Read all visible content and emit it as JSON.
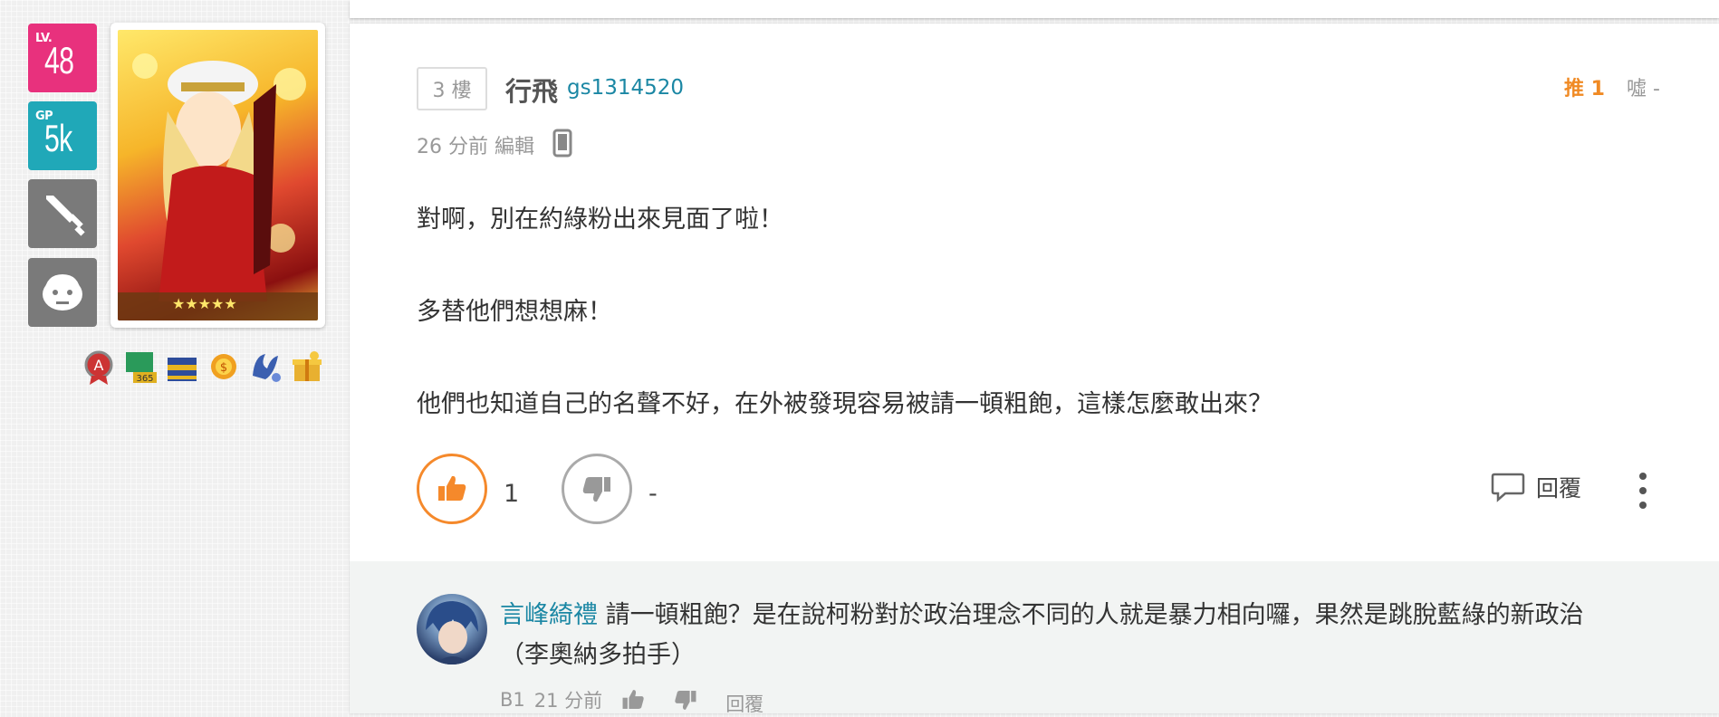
{
  "sidebar": {
    "level": {
      "caption": "LV.",
      "value": "48"
    },
    "gp": {
      "caption": "GP",
      "value": "5k"
    }
  },
  "post": {
    "floor": "3 樓",
    "author_name": "行飛",
    "author_id": "gs1314520",
    "push_label": "推 1",
    "boo_label": "噓 -",
    "time": "26 分前 編輯",
    "lines": [
      "對啊，別在約綠粉出來見面了啦！",
      "多替他們想想麻！",
      "他們也知道自己的名聲不好，在外被發現容易被請一頓粗飽，這樣怎麼敢出來？"
    ],
    "gp_count": "1",
    "bp_count": "-",
    "reply_label": "回覆"
  },
  "comment": {
    "user": "言峰綺禮",
    "text": " 請一頓粗飽？是在說柯粉對於政治理念不同的人就是暴力相向囉，果然是跳脫藍綠的新政治 （李奧納多拍手）",
    "floor": "B1",
    "time": "21 分前",
    "reply_label": "回覆"
  },
  "colors": {
    "level_badge": "#e8317d",
    "gp_badge": "#20a8b8",
    "push": "#f08a24",
    "link": "#1b87a4"
  }
}
